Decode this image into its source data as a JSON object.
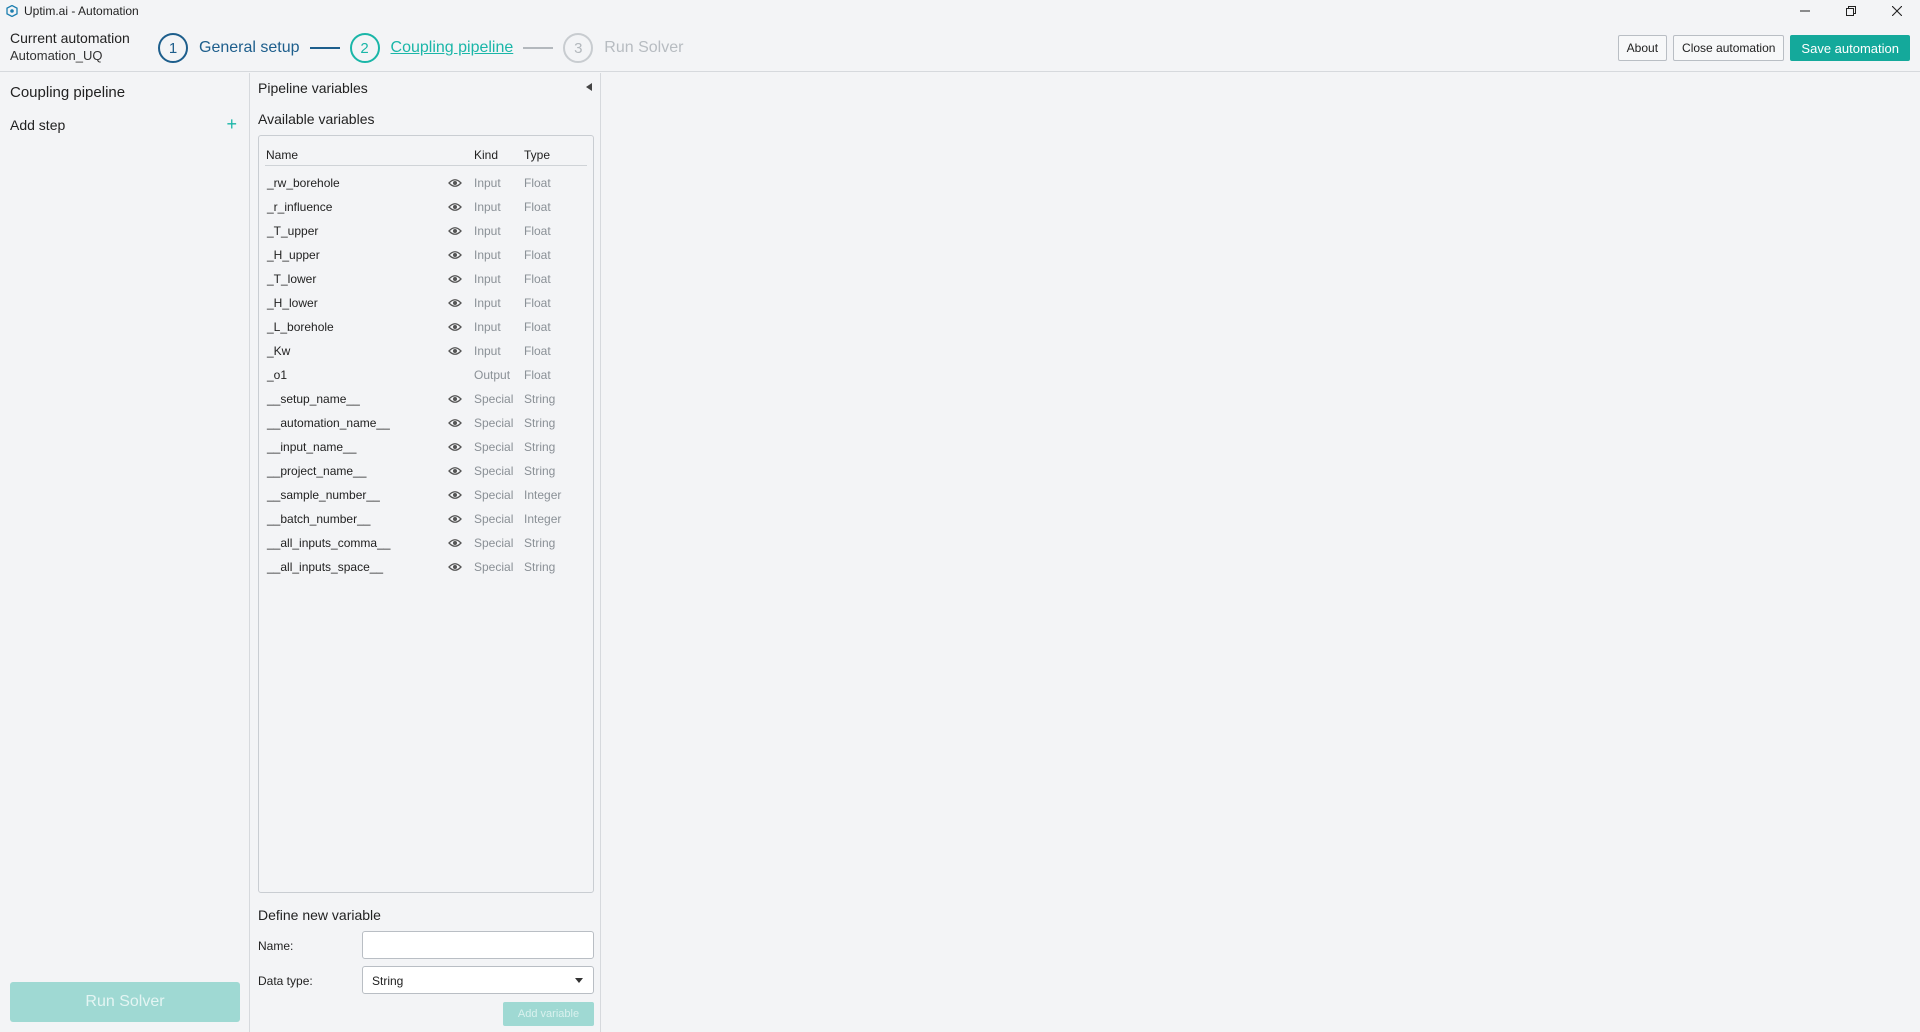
{
  "window": {
    "title": "Uptim.ai - Automation"
  },
  "header": {
    "current_automation_label": "Current automation",
    "current_automation_value": "Automation_UQ",
    "steps": [
      {
        "number": "1",
        "label": "General setup"
      },
      {
        "number": "2",
        "label": "Coupling pipeline"
      },
      {
        "number": "3",
        "label": "Run Solver"
      }
    ],
    "about_label": "About",
    "close_label": "Close automation",
    "save_label": "Save automation"
  },
  "sidebar": {
    "title": "Coupling pipeline",
    "add_step_label": "Add step",
    "add_step_icon": "+",
    "run_solver_label": "Run Solver"
  },
  "panel": {
    "title": "Pipeline variables",
    "available_title": "Available variables",
    "columns": {
      "name": "Name",
      "kind": "Kind",
      "type": "Type"
    },
    "variables": [
      {
        "name": "_rw_borehole",
        "visible": true,
        "kind": "Input",
        "type": "Float"
      },
      {
        "name": "_r_influence",
        "visible": true,
        "kind": "Input",
        "type": "Float"
      },
      {
        "name": "_T_upper",
        "visible": true,
        "kind": "Input",
        "type": "Float"
      },
      {
        "name": "_H_upper",
        "visible": true,
        "kind": "Input",
        "type": "Float"
      },
      {
        "name": "_T_lower",
        "visible": true,
        "kind": "Input",
        "type": "Float"
      },
      {
        "name": "_H_lower",
        "visible": true,
        "kind": "Input",
        "type": "Float"
      },
      {
        "name": "_L_borehole",
        "visible": true,
        "kind": "Input",
        "type": "Float"
      },
      {
        "name": "_Kw",
        "visible": true,
        "kind": "Input",
        "type": "Float"
      },
      {
        "name": "_o1",
        "visible": false,
        "kind": "Output",
        "type": "Float"
      },
      {
        "name": "__setup_name__",
        "visible": true,
        "kind": "Special",
        "type": "String"
      },
      {
        "name": "__automation_name__",
        "visible": true,
        "kind": "Special",
        "type": "String"
      },
      {
        "name": "__input_name__",
        "visible": true,
        "kind": "Special",
        "type": "String"
      },
      {
        "name": "__project_name__",
        "visible": true,
        "kind": "Special",
        "type": "String"
      },
      {
        "name": "__sample_number__",
        "visible": true,
        "kind": "Special",
        "type": "Integer"
      },
      {
        "name": "__batch_number__",
        "visible": true,
        "kind": "Special",
        "type": "Integer"
      },
      {
        "name": "__all_inputs_comma__",
        "visible": true,
        "kind": "Special",
        "type": "String"
      },
      {
        "name": "__all_inputs_space__",
        "visible": true,
        "kind": "Special",
        "type": "String"
      }
    ],
    "define_title": "Define new variable",
    "name_label": "Name:",
    "name_value": "",
    "data_type_label": "Data type:",
    "data_type_value": "String",
    "add_variable_label": "Add variable"
  },
  "colors": {
    "accent": "#14a99b",
    "step_done": "#1d5e8c",
    "disabled_accent": "#9fd9d3"
  }
}
